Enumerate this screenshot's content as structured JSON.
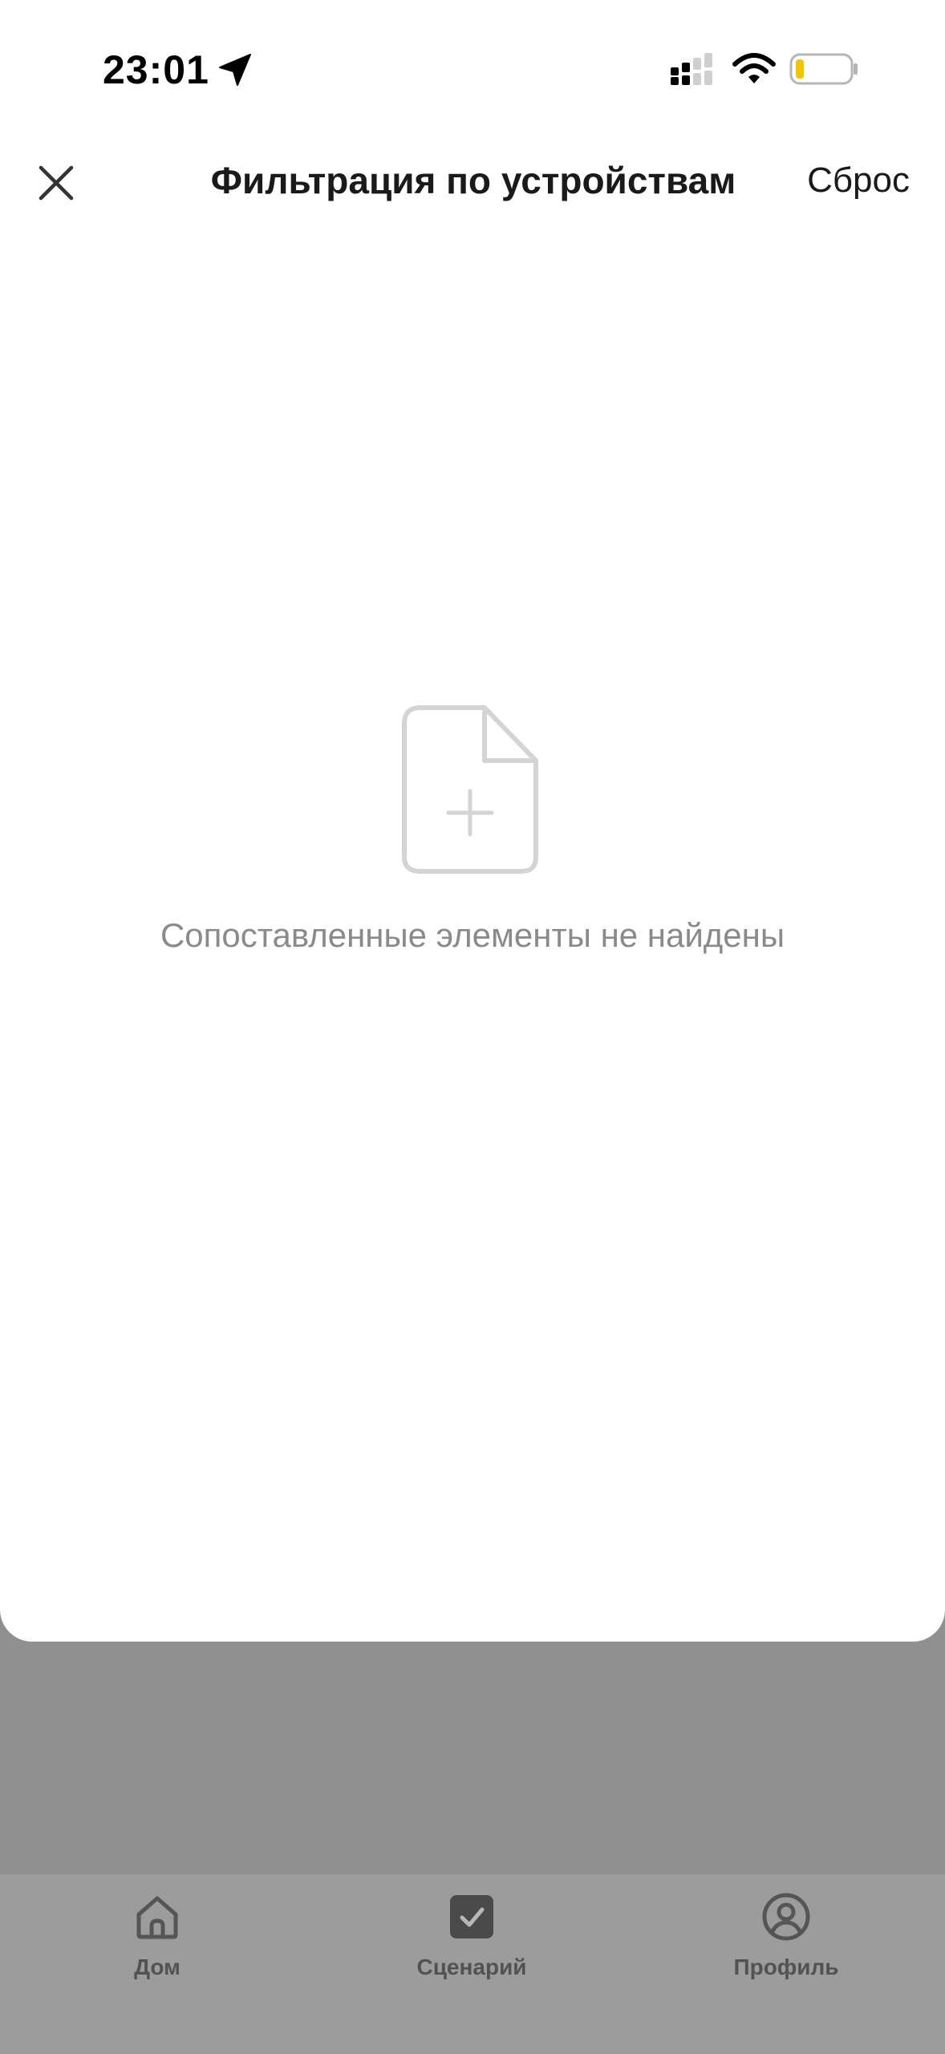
{
  "status_bar": {
    "time": "23:01",
    "icons": [
      "location-arrow-icon",
      "signal-icon",
      "wifi-icon",
      "battery-low-icon"
    ],
    "battery_color": "#f5c400"
  },
  "header": {
    "title": "Фильтрация по устройствам",
    "reset_label": "Сброс",
    "close_icon": "close-icon"
  },
  "empty_state": {
    "icon": "add-document-icon",
    "message": "Сопоставленные элементы не найдены"
  },
  "tab_bar": {
    "items": [
      {
        "label": "Дом",
        "icon": "home-icon"
      },
      {
        "label": "Сценарий",
        "icon": "checkbox-icon"
      },
      {
        "label": "Профиль",
        "icon": "profile-icon"
      }
    ]
  },
  "colors": {
    "sheet_background": "#ffffff",
    "overlay_background": "#8f8f8f",
    "empty_text": "#8a8a8a",
    "title_text": "#1a1a1a"
  }
}
